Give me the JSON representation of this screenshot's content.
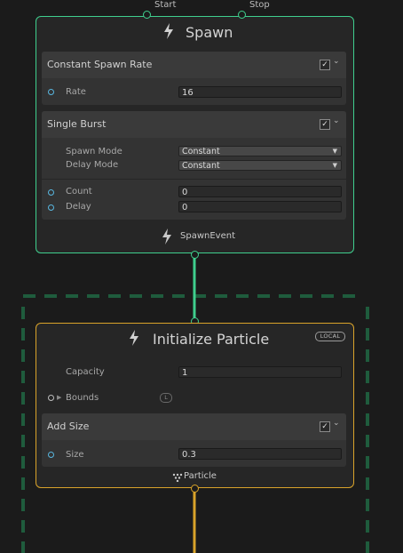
{
  "spawn": {
    "title": "Spawn",
    "port_start": "Start",
    "port_stop": "Stop",
    "footer_label": "SpawnEvent",
    "blocks": [
      {
        "title": "Constant Spawn Rate",
        "enabled": true,
        "rows": [
          {
            "label": "Rate",
            "value": "16"
          }
        ]
      },
      {
        "title": "Single Burst",
        "enabled": true,
        "dropdowns": [
          {
            "label": "Spawn Mode",
            "value": "Constant"
          },
          {
            "label": "Delay Mode",
            "value": "Constant"
          }
        ],
        "rows": [
          {
            "label": "Count",
            "value": "0"
          },
          {
            "label": "Delay",
            "value": "0"
          }
        ]
      }
    ]
  },
  "init": {
    "title": "Initialize Particle",
    "space_badge": "LOCAL",
    "capacity_label": "Capacity",
    "capacity_value": "1",
    "bounds_label": "Bounds",
    "bounds_badge": "L",
    "footer_label": "Particle",
    "add_size": {
      "title": "Add Size",
      "enabled": true,
      "row_label": "Size",
      "row_value": "0.3"
    }
  },
  "colors": {
    "spawn_accent": "#3fcf8e",
    "init_accent": "#d9a32a",
    "system_dash": "#1f5c3d",
    "slot": "#59b7e0"
  },
  "icons": {
    "check": "✓",
    "chevron": "⌄",
    "dropdown_arrow": "▼",
    "foldout": "▶"
  }
}
